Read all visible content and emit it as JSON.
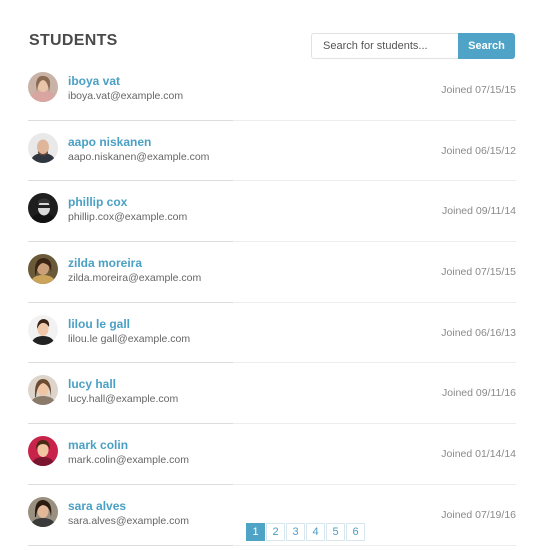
{
  "header": {
    "title": "STUDENTS",
    "search_placeholder": "Search for students...",
    "search_button": "Search"
  },
  "students": [
    {
      "name": "iboya vat",
      "email": "iboya.vat@example.com",
      "joined": "Joined 07/15/15"
    },
    {
      "name": "aapo niskanen",
      "email": "aapo.niskanen@example.com",
      "joined": "Joined 06/15/12"
    },
    {
      "name": "phillip cox",
      "email": "phillip.cox@example.com",
      "joined": "Joined 09/11/14"
    },
    {
      "name": "zilda moreira",
      "email": "zilda.moreira@example.com",
      "joined": "Joined 07/15/15"
    },
    {
      "name": "lilou le gall",
      "email": "lilou.le gall@example.com",
      "joined": "Joined 06/16/13"
    },
    {
      "name": "lucy hall",
      "email": "lucy.hall@example.com",
      "joined": "Joined 09/11/16"
    },
    {
      "name": "mark colin",
      "email": "mark.colin@example.com",
      "joined": "Joined 01/14/14"
    },
    {
      "name": "sara alves",
      "email": "sara.alves@example.com",
      "joined": "Joined 07/19/16"
    }
  ],
  "pagination": {
    "pages": [
      "1",
      "2",
      "3",
      "4",
      "5",
      "6"
    ],
    "current": "1"
  },
  "colors": {
    "accent": "#4fa3c7",
    "link": "#4aa0c4"
  }
}
